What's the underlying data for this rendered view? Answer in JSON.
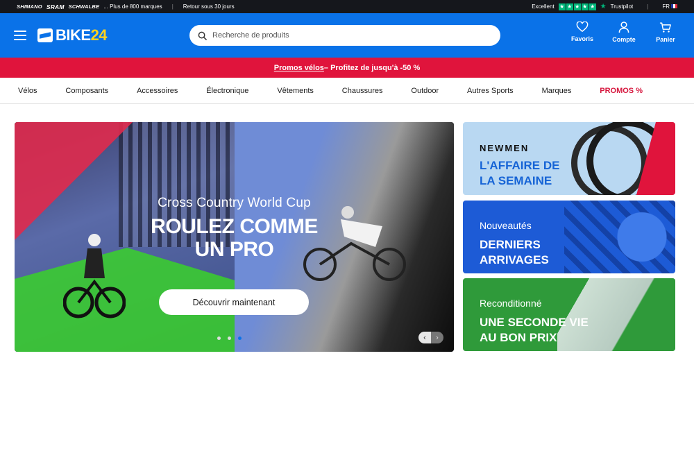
{
  "topbar": {
    "brands": [
      "SHIMANO",
      "SRAM",
      "SCHWALBE"
    ],
    "brands_more": "... Plus de 800 marques",
    "returns": "Retour sous 30 jours",
    "rating_label": "Excellent",
    "trustpilot": "Trustpilot",
    "lang": "FR"
  },
  "header": {
    "logo_text": "BIKE",
    "logo_num": "24",
    "search_placeholder": "Recherche de produits",
    "favorites": "Favoris",
    "account": "Compte",
    "cart": "Panier"
  },
  "promo": {
    "link": "Promos vélos",
    "text": " – Profitez de jusqu'à -50 %"
  },
  "nav": {
    "items": [
      "Vélos",
      "Composants",
      "Accessoires",
      "Électronique",
      "Vêtements",
      "Chaussures",
      "Outdoor",
      "Autres Sports",
      "Marques"
    ],
    "promo": "PROMOS %"
  },
  "hero": {
    "kicker": "Cross Country World Cup",
    "headline_1": "ROULEZ COMME",
    "headline_2": "UN PRO",
    "cta": "Découvrir maintenant",
    "arrow_prev": "‹",
    "arrow_next": "›"
  },
  "cards": [
    {
      "brand": "NEWMEN",
      "title_1": "L'AFFAIRE DE",
      "title_2": "LA SEMAINE"
    },
    {
      "kicker": "Nouveautés",
      "title_1": "DERNIERS",
      "title_2": "ARRIVAGES"
    },
    {
      "kicker": "Reconditionné",
      "title_1": "UNE SECONDE VIE",
      "title_2": "AU BON PRIX"
    }
  ],
  "colors": {
    "header_blue": "#0a72e8",
    "promo_red": "#e0143c",
    "logo_yellow": "#ffd21f",
    "trustpilot_green": "#00b67a"
  }
}
